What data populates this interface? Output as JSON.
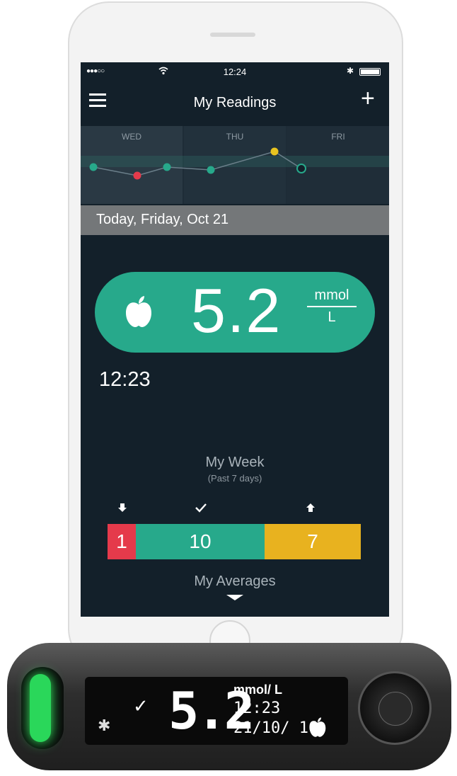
{
  "status_bar": {
    "signal": "●●●○○",
    "wifi": "wifi",
    "time": "12:24",
    "bluetooth": "✱",
    "battery": "battery-full"
  },
  "nav": {
    "title": "My Readings",
    "menu_icon": "hamburger-icon",
    "add_label": "+"
  },
  "week_strip": {
    "days": [
      "WED",
      "THU",
      "FRI"
    ],
    "points": [
      {
        "day": "WED",
        "status": "in-range",
        "color": "#27a98b"
      },
      {
        "day": "WED",
        "status": "low",
        "color": "#e53a4b"
      },
      {
        "day": "WED",
        "status": "in-range",
        "color": "#27a98b"
      },
      {
        "day": "THU",
        "status": "in-range",
        "color": "#27a98b"
      },
      {
        "day": "THU",
        "status": "high",
        "color": "#e8c31f"
      },
      {
        "day": "FRI",
        "status": "current",
        "color": "#27a98b"
      }
    ]
  },
  "date_bar": {
    "label": "Today, Friday, Oct 21"
  },
  "reading": {
    "value": "5.2",
    "unit_top": "mmol",
    "unit_bottom": "L",
    "time": "12:23",
    "meal_icon": "apple-icon"
  },
  "my_week": {
    "title": "My Week",
    "subtitle": "(Past 7 days)",
    "low_count": "1",
    "in_range_count": "10",
    "high_count": "7",
    "colors": {
      "low": "#e53a4b",
      "in_range": "#27a98b",
      "high": "#e8b21f"
    }
  },
  "averages": {
    "label": "My Averages"
  },
  "meter": {
    "value": "5.2",
    "unit": "mmol/ L",
    "time": "12:23",
    "date": "21/10/ 16",
    "check": "✓",
    "bluetooth": "✱"
  }
}
